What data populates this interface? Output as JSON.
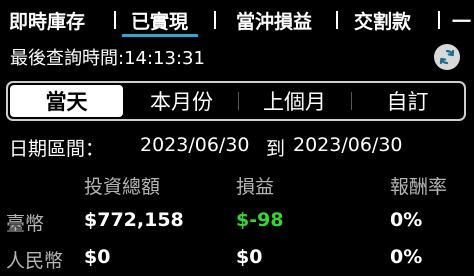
{
  "top_tabs": [
    {
      "label": "即時庫存",
      "active": false
    },
    {
      "label": "已實現",
      "active": true
    },
    {
      "label": "當沖損益",
      "active": false
    },
    {
      "label": "交割款",
      "active": false
    },
    {
      "label": "一",
      "active": false
    }
  ],
  "query": {
    "label": "最後查詢時間:",
    "time": "14:13:31"
  },
  "range_tabs": [
    {
      "label": "當天",
      "active": true
    },
    {
      "label": "本月份",
      "active": false
    },
    {
      "label": "上個月",
      "active": false
    },
    {
      "label": "自訂",
      "active": false
    }
  ],
  "date_range": {
    "label": "日期區間：",
    "start": "2023/06/30",
    "connector": "到",
    "end": "2023/06/30"
  },
  "table": {
    "headers": [
      "投資總額",
      "損益",
      "報酬率"
    ],
    "rows": [
      {
        "currency": "臺幣",
        "investment": "$772,158",
        "profit": "$-98",
        "return": "0%"
      },
      {
        "currency": "人民幣",
        "investment": "$0",
        "profit": "$0",
        "return": "0%"
      }
    ]
  },
  "colors": {
    "accent": "#2aa8d8",
    "negative_profit": "#33d633",
    "background": "#000000"
  }
}
